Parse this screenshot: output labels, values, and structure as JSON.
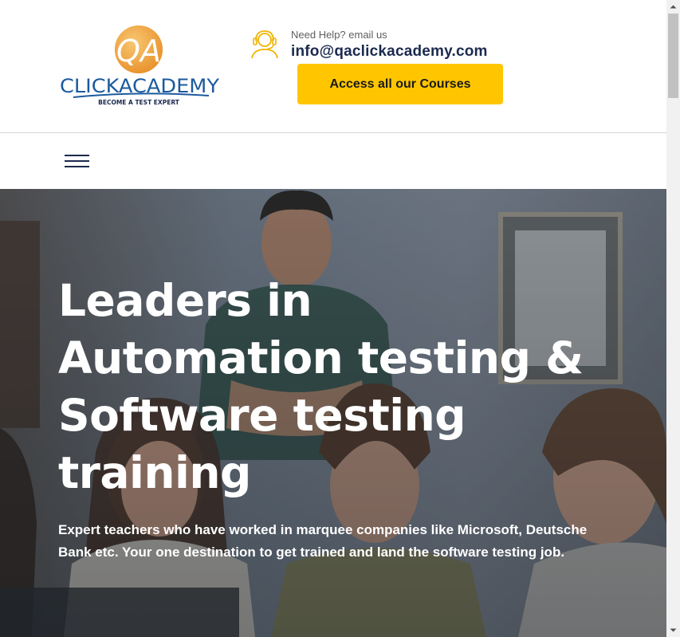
{
  "header": {
    "logo": {
      "mark": "QA",
      "name": "CLICKACADEMY",
      "tagline": "BECOME A TEST EXPERT"
    },
    "help_text": "Need Help? email us",
    "email": "info@qaclickacademy.com",
    "cta_label": "Access all our Courses",
    "support_icon": "headset-support-icon"
  },
  "nav": {
    "menu_icon": "hamburger-menu-icon"
  },
  "hero": {
    "title_lines": [
      "Leaders in",
      "Automation testing &",
      "Software testing",
      "training"
    ],
    "subtitle_lines": [
      "Expert teachers who have worked in marquee companies like Microsoft, Deutsche",
      "Bank etc. Your one destination to get trained and land the software testing job."
    ]
  },
  "colors": {
    "accent": "#ffc600",
    "navy": "#1b2a4e",
    "logo_orange": "#f2a63a",
    "logo_blue": "#1c5a9e"
  }
}
